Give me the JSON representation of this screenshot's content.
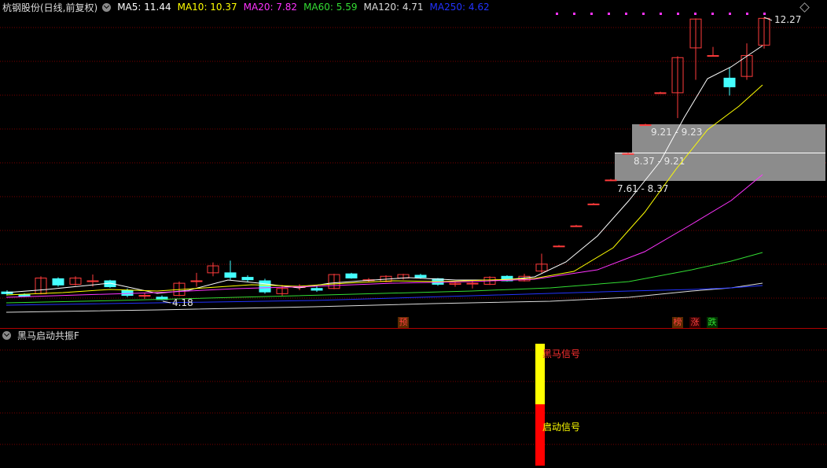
{
  "header": {
    "stock_name": "杭钢股份(日线,前复权)",
    "ma5": "MA5: 11.44",
    "ma10": "MA10: 10.37",
    "ma20": "MA20: 7.82",
    "ma60": "MA60: 5.59",
    "ma120": "MA120: 4.71",
    "ma250": "MA250: 4.62"
  },
  "colors": {
    "ma5": "#ffffff",
    "ma10": "#ffff00",
    "ma20": "#ff33ff",
    "ma60": "#33dd33",
    "ma120": "#dddddd",
    "ma250": "#2233ff",
    "up": "#ff3b3b",
    "down": "#44ffff",
    "grid": "#7a0000"
  },
  "price_labels": {
    "high": "12.27",
    "low": "4.18"
  },
  "zones": [
    {
      "label": "9.21 - 9.23",
      "low": 9.21,
      "high": 9.23
    },
    {
      "label": "8.37 - 9.21",
      "low": 8.37,
      "high": 9.21
    },
    {
      "label": "7.61 - 8.37",
      "low": 7.61,
      "high": 8.37
    }
  ],
  "badges": {
    "yu": "预",
    "bang": "榜",
    "zhang": "涨",
    "die": "跌"
  },
  "indicator": {
    "title": "黑马启动共振F",
    "signal_black_horse": "黑马信号",
    "signal_start": "启动信号"
  },
  "icons": {
    "header_toggle": "chevron-down-icon",
    "indicator_toggle": "chevron-down-icon",
    "corner": "diamond-icon"
  }
}
